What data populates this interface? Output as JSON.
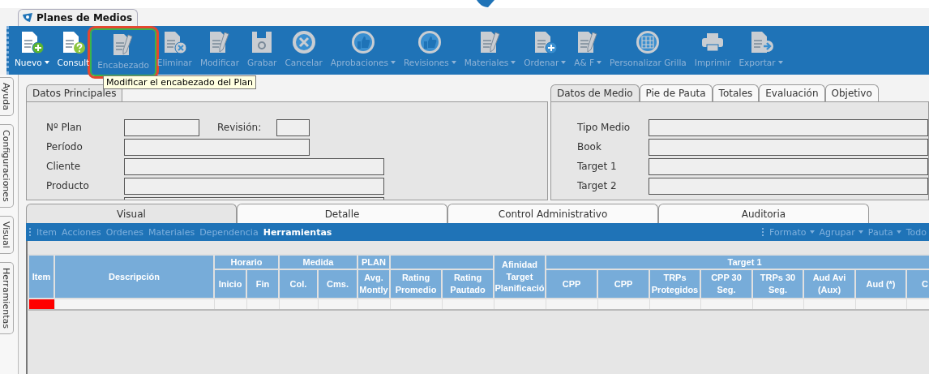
{
  "document_tab": {
    "title": "Planes de Medios"
  },
  "toolbar": [
    {
      "label": "Nuevo",
      "kind": "doc-plus",
      "disabled": false,
      "dropdown": true,
      "highlighted": false
    },
    {
      "label": "Consult",
      "kind": "doc-question",
      "disabled": false,
      "dropdown": false,
      "highlighted": false
    },
    {
      "label": "Encabezado",
      "kind": "doc-pencil",
      "disabled": true,
      "dropdown": false,
      "highlighted": true
    },
    {
      "label": "Eliminar",
      "kind": "doc-x",
      "disabled": true,
      "dropdown": false,
      "highlighted": false
    },
    {
      "label": "Modificar",
      "kind": "doc-pencil",
      "disabled": true,
      "dropdown": false,
      "highlighted": false
    },
    {
      "label": "Grabar",
      "kind": "floppy",
      "disabled": true,
      "dropdown": false,
      "highlighted": false
    },
    {
      "label": "Cancelar",
      "kind": "circle-x",
      "disabled": true,
      "dropdown": false,
      "highlighted": false
    },
    {
      "label": "Aprobaciones",
      "kind": "thumb",
      "disabled": true,
      "dropdown": true,
      "highlighted": false
    },
    {
      "label": "Revisiones",
      "kind": "thumb",
      "disabled": true,
      "dropdown": true,
      "highlighted": false
    },
    {
      "label": "Materiales",
      "kind": "doc-pencil",
      "disabled": true,
      "dropdown": true,
      "highlighted": false
    },
    {
      "label": "Ordenar",
      "kind": "doc-plus",
      "disabled": true,
      "dropdown": true,
      "highlighted": false
    },
    {
      "label": "A& F",
      "kind": "doc-pencil",
      "disabled": true,
      "dropdown": true,
      "highlighted": false
    },
    {
      "label": "Personalizar Grilla",
      "kind": "grid",
      "disabled": true,
      "dropdown": false,
      "highlighted": false
    },
    {
      "label": "Imprimir",
      "kind": "printer",
      "disabled": true,
      "dropdown": false,
      "highlighted": false
    },
    {
      "label": "Exportar",
      "kind": "doc-arrow",
      "disabled": true,
      "dropdown": true,
      "highlighted": false
    }
  ],
  "tooltip": "Modificar el encabezado del Plan",
  "side_tabs": [
    "Ayuda",
    "Configuraciones",
    "Visual",
    "Herramientas"
  ],
  "datos_principales": {
    "title": "Datos Principales",
    "fields": [
      {
        "label": "Nº Plan",
        "kind": "short"
      },
      {
        "label": "Revisión:",
        "kind": "tiny"
      },
      {
        "label": "Período",
        "kind": "medium"
      },
      {
        "label": "Cliente",
        "kind": "long"
      },
      {
        "label": "Producto",
        "kind": "long"
      },
      {
        "kind": "long"
      }
    ]
  },
  "medio_tabs": [
    {
      "label": "Datos de Medio",
      "selected": true
    },
    {
      "label": "Pie de Pauta",
      "selected": false
    },
    {
      "label": "Totales",
      "selected": false
    },
    {
      "label": "Evaluación",
      "selected": false
    },
    {
      "label": "Objetivo",
      "selected": false
    }
  ],
  "medio_fields": [
    "Tipo Medio",
    "Book",
    "Target 1",
    "Target 2"
  ],
  "bottom_tabs": [
    {
      "label": "Visual",
      "selected": true
    },
    {
      "label": "Detalle",
      "selected": false
    },
    {
      "label": "Control Administrativo",
      "selected": false
    },
    {
      "label": "Auditoria",
      "selected": false
    }
  ],
  "menu_left": [
    {
      "label": "Item",
      "selected": false
    },
    {
      "label": "Acciones",
      "selected": false
    },
    {
      "label": "Ordenes",
      "selected": false
    },
    {
      "label": "Materiales",
      "selected": false
    },
    {
      "label": "Dependencia",
      "selected": false
    },
    {
      "label": "Herramientas",
      "selected": true
    }
  ],
  "menu_right": [
    {
      "label": "Formato",
      "dropdown": true
    },
    {
      "label": "Agrupar",
      "dropdown": true
    },
    {
      "label": "Pauta",
      "dropdown": true
    },
    {
      "label": "Todo",
      "dropdown": false
    }
  ],
  "grid": {
    "column_groups": [
      {
        "label": "Item"
      },
      {
        "label": "Descripción"
      },
      {
        "label": "Horario",
        "columns": [
          "Inicio",
          "Fin"
        ]
      },
      {
        "label": "Medida",
        "columns": [
          "Col.",
          "Cms."
        ]
      },
      {
        "label": "PLAN",
        "columns": [
          "Avg. Montly"
        ]
      },
      {
        "columns": [
          "Rating Promedio",
          "Rating Pautado"
        ]
      },
      {
        "label": "Afinidad Target Planificació"
      },
      {
        "label": "Target 1",
        "columns": [
          "CPP",
          "CPP",
          "TRPs Protegidos",
          "CPP 30 Seg.",
          "TRPs 30 Seg.",
          "Aud Avi (Aux)",
          "Aud (*)",
          "C"
        ]
      }
    ],
    "rows": [
      {
        "marked": true
      }
    ]
  }
}
